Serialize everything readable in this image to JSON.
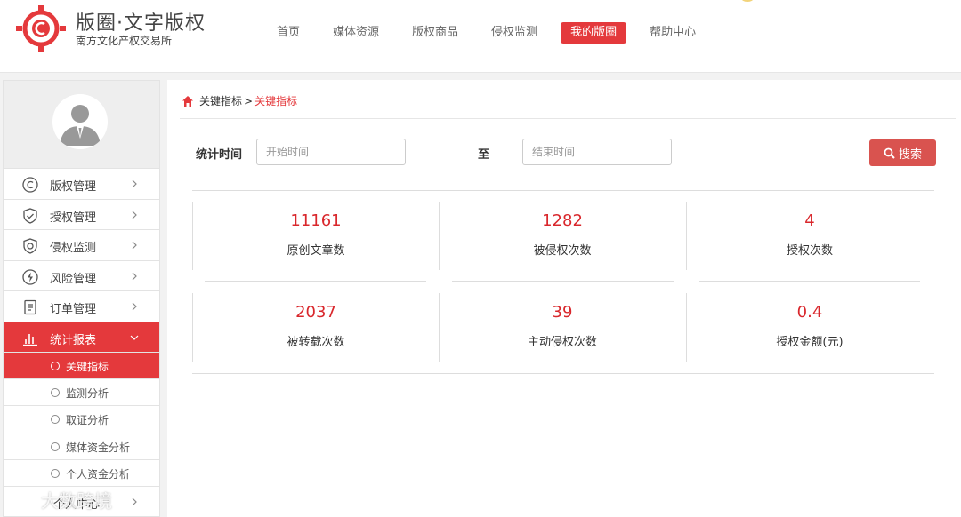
{
  "header": {
    "brand_title": "版圈·文字版权",
    "brand_subtitle": "南方文化产权交易所",
    "nav": [
      {
        "label": "首页",
        "active": false
      },
      {
        "label": "媒体资源",
        "active": false
      },
      {
        "label": "版权商品",
        "active": false
      },
      {
        "label": "侵权监测",
        "active": false
      },
      {
        "label": "我的版圈",
        "active": true
      },
      {
        "label": "帮助中心",
        "active": false
      }
    ]
  },
  "sidebar": {
    "menu": [
      {
        "label": "版权管理",
        "icon": "copyright-icon"
      },
      {
        "label": "授权管理",
        "icon": "shield-check-icon"
      },
      {
        "label": "侵权监测",
        "icon": "shield-icon"
      },
      {
        "label": "风险管理",
        "icon": "lightning-icon"
      },
      {
        "label": "订单管理",
        "icon": "document-icon"
      },
      {
        "label": "统计报表",
        "icon": "bar-chart-icon",
        "active": true
      }
    ],
    "submenu": [
      {
        "label": "关键指标",
        "active": true
      },
      {
        "label": "监测分析"
      },
      {
        "label": "取证分析"
      },
      {
        "label": "媒体资金分析"
      },
      {
        "label": "个人资金分析"
      }
    ],
    "last_item": {
      "label": "个人中心"
    }
  },
  "breadcrumb": {
    "parent": "关键指标",
    "separator": ">",
    "current": "关键指标"
  },
  "filter": {
    "label": "统计时间",
    "start_placeholder": "开始时间",
    "to_label": "至",
    "end_placeholder": "结束时间",
    "search_label": "搜索"
  },
  "stats": [
    {
      "value": "11161",
      "label": "原创文章数"
    },
    {
      "value": "1282",
      "label": "被侵权次数"
    },
    {
      "value": "4",
      "label": "授权次数"
    },
    {
      "value": "2037",
      "label": "被转载次数"
    },
    {
      "value": "39",
      "label": "主动侵权次数"
    },
    {
      "value": "0.4",
      "label": "授权金额(元)"
    }
  ],
  "watermark": "大数跨境",
  "colors": {
    "accent": "#e4393c",
    "stat_value": "#d9272c",
    "search_button": "#d9534f"
  }
}
